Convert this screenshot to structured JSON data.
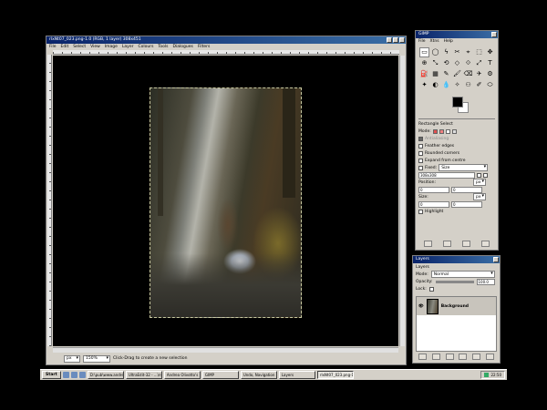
{
  "image_window": {
    "title": "rlxNt07_023.png-1.0 (RGB, 1 layer) 308x451",
    "menu": [
      "File",
      "Edit",
      "Select",
      "View",
      "Image",
      "Layer",
      "Colours",
      "Tools",
      "Dialogues",
      "Filters"
    ],
    "status": {
      "unit": "px",
      "zoom": "150%",
      "message": "Click-Drag to create a new selection"
    }
  },
  "toolbox": {
    "title": "GIMP",
    "menu": [
      "File",
      "Xtns",
      "Help"
    ],
    "tools": [
      "▭",
      "◯",
      "ϟ",
      "✂",
      "⌖",
      "⬚",
      "✥",
      "⊕",
      "⤡",
      "⟲",
      "◇",
      "⟐",
      "⤢",
      "T",
      "⛽",
      "▦",
      "✎",
      "🖌",
      "⌫",
      "✈",
      "⚙",
      "✦",
      "◐",
      "💧",
      "✧",
      "⚇",
      "✐",
      "⬭"
    ],
    "tool_options": {
      "title": "Rectangle Select",
      "mode_label": "Mode:",
      "antialiasing": "Antialiasing",
      "feather": "Feather edges",
      "rounded": "Rounded corners",
      "expand": "Expand from centre",
      "fixed_label": "Fixed:",
      "fixed_value": "Size",
      "size_value": "308x308",
      "position_label": "Position:",
      "size_label": "Size:",
      "unit": "px",
      "pos_x": "0",
      "pos_y": "0",
      "size_w": "0",
      "size_h": "0",
      "highlight": "Highlight"
    }
  },
  "layers": {
    "title": "Layers",
    "tab": "Layers",
    "mode_label": "Mode:",
    "mode_value": "Normal",
    "opacity_label": "Opacity:",
    "opacity_value": "100.0",
    "lock_label": "Lock:",
    "layer_name": "Background"
  },
  "taskbar": {
    "start": "Start",
    "tasks": [
      "D:\\pub\\www.andre...",
      "UltraEdit-32 - ...\\nych",
      "Andrea Olivotto's H...",
      "GIMP",
      "Undo, Navigation",
      "Layers",
      "rlxNt07_023.png-1.0"
    ],
    "clock": "22:50"
  }
}
